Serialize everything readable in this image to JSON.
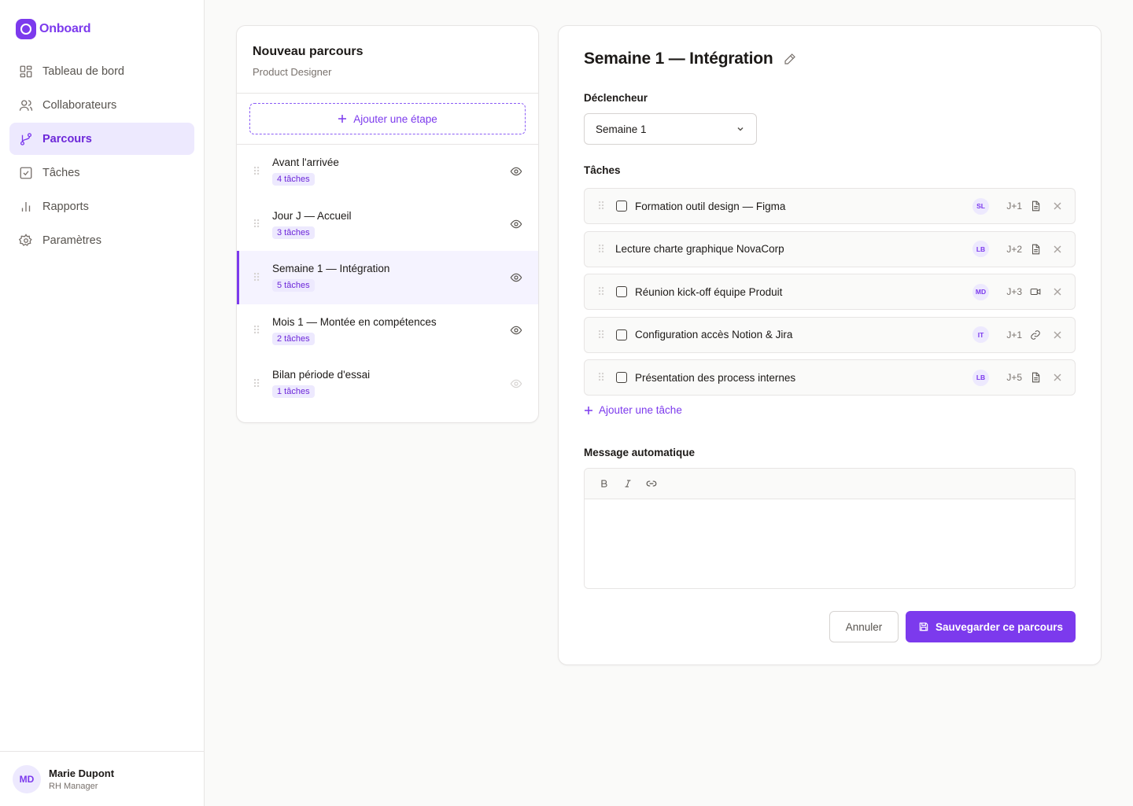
{
  "brand": {
    "name": "Onboard"
  },
  "nav": [
    {
      "label": "Tableau de bord",
      "icon": "dashboard-icon"
    },
    {
      "label": "Collaborateurs",
      "icon": "users-icon"
    },
    {
      "label": "Parcours",
      "icon": "route-icon",
      "active": true
    },
    {
      "label": "Tâches",
      "icon": "checkbox-icon"
    },
    {
      "label": "Rapports",
      "icon": "bar-chart-icon"
    },
    {
      "label": "Paramètres",
      "icon": "gear-icon"
    }
  ],
  "user": {
    "initials": "MD",
    "name": "Marie Dupont",
    "role": "RH Manager"
  },
  "steps_panel": {
    "title": "Nouveau parcours",
    "subtitle": "Product Designer",
    "add_label": "Ajouter une étape",
    "steps": [
      {
        "name": "Avant l'arrivée",
        "badge": "4 tâches"
      },
      {
        "name": "Jour J — Accueil",
        "badge": "3 tâches"
      },
      {
        "name": "Semaine 1 — Intégration",
        "badge": "5 tâches"
      },
      {
        "name": "Mois 1 — Montée en compétences",
        "badge": "2 tâches"
      },
      {
        "name": "Bilan période d'essai",
        "badge": "1 tâches"
      }
    ]
  },
  "editor": {
    "title": "Semaine 1 — Intégration",
    "trigger_label": "Déclencheur",
    "trigger_value": "Semaine 1",
    "tasks_label": "Tâches",
    "tasks": [
      {
        "name": "Formation outil design — Figma",
        "assignee": "SL",
        "delay": "J+1",
        "type_icon": "document-icon",
        "checkbox": true
      },
      {
        "name": "Lecture charte graphique NovaCorp",
        "assignee": "LB",
        "delay": "J+2",
        "type_icon": "document-icon",
        "checkbox": false
      },
      {
        "name": "Réunion kick-off équipe Produit",
        "assignee": "MD",
        "delay": "J+3",
        "type_icon": "video-icon",
        "checkbox": true
      },
      {
        "name": "Configuration accès Notion & Jira",
        "assignee": "IT",
        "delay": "J+1",
        "type_icon": "link-icon",
        "checkbox": true
      },
      {
        "name": "Présentation des process internes",
        "assignee": "LB",
        "delay": "J+5",
        "type_icon": "document-icon",
        "checkbox": true
      }
    ],
    "add_task_label": "Ajouter une tâche",
    "message_label": "Message automatique",
    "message_value": "",
    "cancel_label": "Annuler",
    "save_label": "Sauvegarder ce parcours"
  },
  "colors": {
    "accent": "#7c3aed",
    "accent_light": "#ede9fe",
    "border": "#e7e5e4"
  }
}
